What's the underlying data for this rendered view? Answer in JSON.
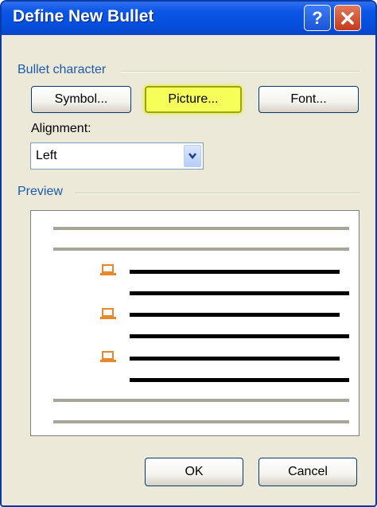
{
  "window": {
    "title": "Define New Bullet",
    "help_label": "?",
    "close_icon": "close-icon"
  },
  "bullet_character": {
    "group_label": "Bullet character",
    "symbol_button": "Symbol...",
    "picture_button": "Picture...",
    "font_button": "Font...",
    "highlight_color": "#f6ff5a"
  },
  "alignment": {
    "label": "Alignment:",
    "selected": "Left"
  },
  "preview": {
    "group_label": "Preview",
    "bullet_icon": "picture-bullet-icon",
    "bullet_color": "#e8882a"
  },
  "footer": {
    "ok_button": "OK",
    "cancel_button": "Cancel"
  }
}
